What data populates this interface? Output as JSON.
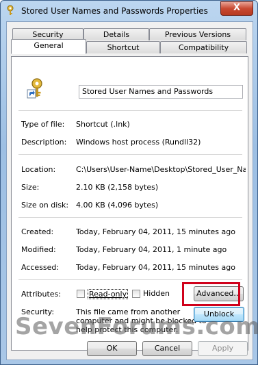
{
  "window": {
    "title": "Stored User Names and Passwords Properties",
    "close_label": "X"
  },
  "tabs_row1": [
    "Security",
    "Details",
    "Previous Versions"
  ],
  "tabs_row2": [
    "General",
    "Shortcut",
    "Compatibility"
  ],
  "general": {
    "name_value": "Stored User Names and Passwords",
    "rows": [
      {
        "label": "Type of file:",
        "value": "Shortcut (.lnk)"
      },
      {
        "label": "Description:",
        "value": "Windows host process (Rundll32)"
      },
      {
        "label": "Location:",
        "value": "C:\\Users\\User-Name\\Desktop\\Stored_User_Names"
      },
      {
        "label": "Size:",
        "value": "2.10 KB (2,158 bytes)"
      },
      {
        "label": "Size on disk:",
        "value": "4.00 KB (4,096 bytes)"
      },
      {
        "label": "Created:",
        "value": "Today, February 04, 2011, 15 minutes ago"
      },
      {
        "label": "Modified:",
        "value": "Today, February 04, 2011, 1 minute ago"
      },
      {
        "label": "Accessed:",
        "value": "Today, February 04, 2011, 15 minutes ago"
      }
    ],
    "attributes_label": "Attributes:",
    "readonly_label": "Read-only",
    "readonly_checked": false,
    "hidden_label": "Hidden",
    "hidden_checked": false,
    "advanced_label": "Advanced...",
    "security_label": "Security:",
    "security_text": [
      "This file came from another",
      "computer and might be blocked to",
      "help protect this computer."
    ],
    "unblock_label": "Unblock"
  },
  "footer": {
    "ok_label": "OK",
    "cancel_label": "Cancel",
    "apply_label": "Apply"
  },
  "watermark": "SevenForums.com",
  "colors": {
    "highlight": "#d0011b",
    "close": "#c94a32"
  }
}
